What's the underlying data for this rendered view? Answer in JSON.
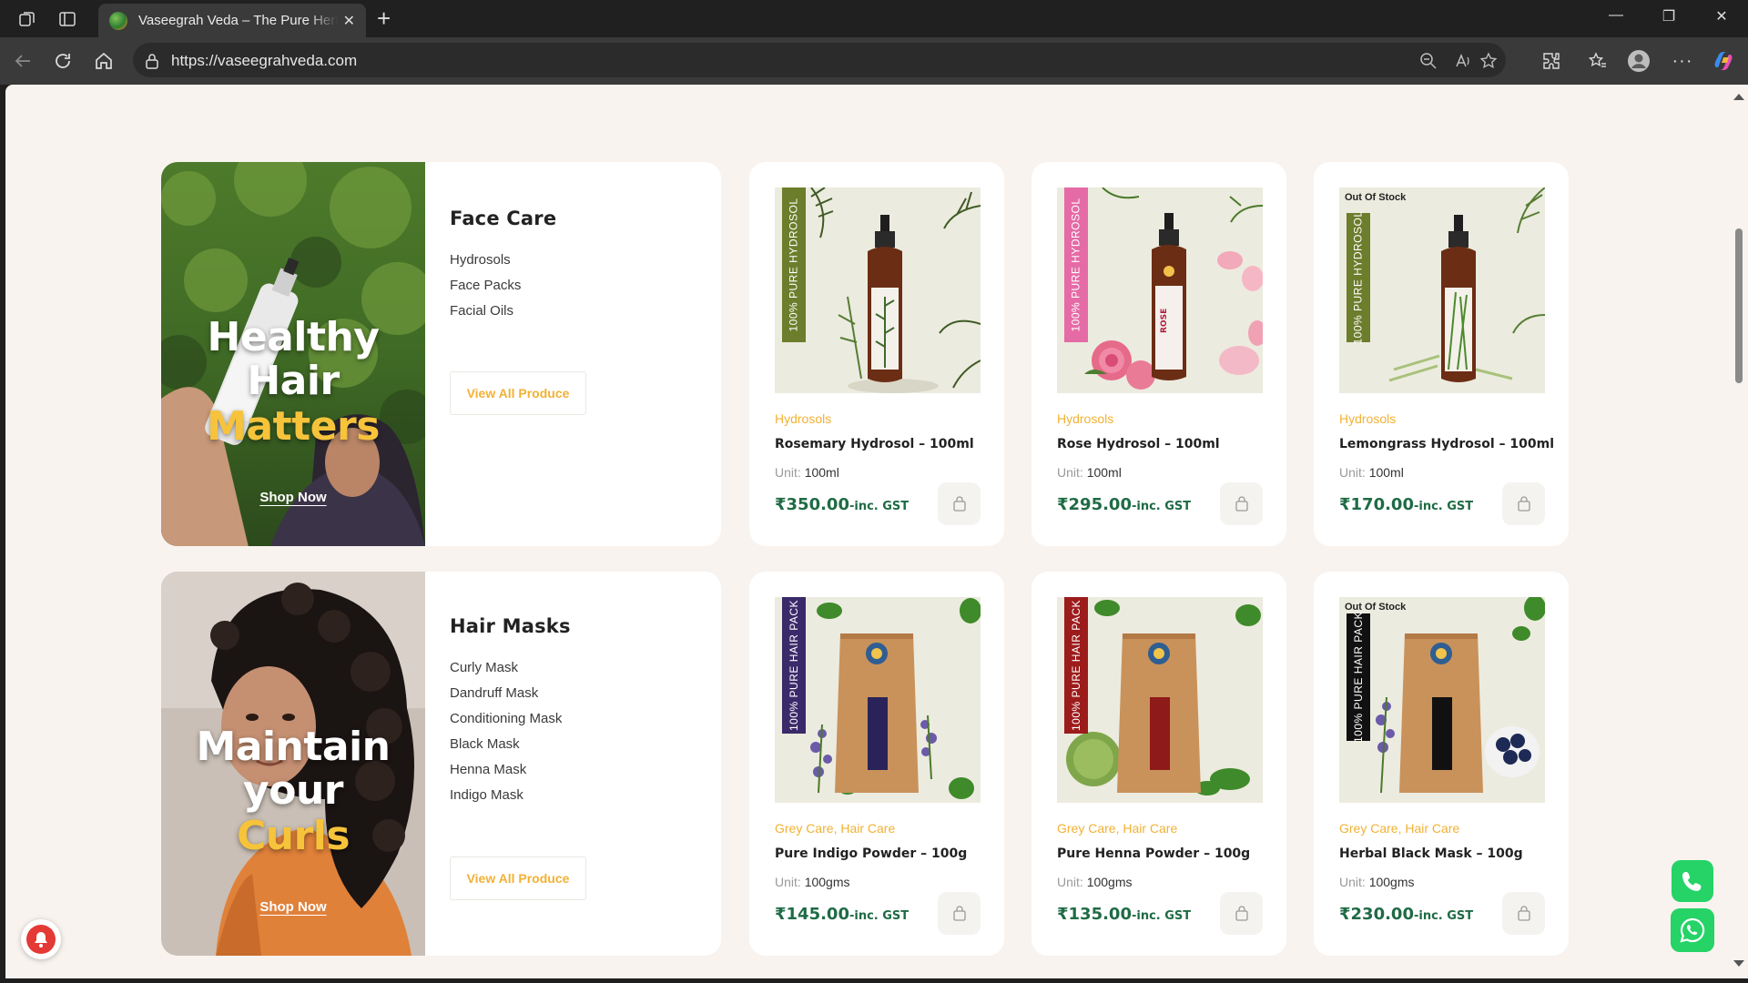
{
  "browser": {
    "tab_title": "Vaseegrah Veda – The Pure Herbal",
    "url": "https://vaseegrahveda.com"
  },
  "categories": [
    {
      "banner": {
        "line1": "Healthy",
        "line2": "Hair",
        "line3": "Matters",
        "cta": "Shop Now"
      },
      "title": "Face Care",
      "links": [
        "Hydrosols",
        "Face Packs",
        "Facial Oils"
      ],
      "button": "View All Produce",
      "products": [
        {
          "category": "Hydrosols",
          "name": "Rosemary Hydrosol – 100ml",
          "unit_label": "Unit:",
          "unit": "100ml",
          "price": "₹350.00",
          "gst": "-inc. GST",
          "band": "100% PURE HYDROSOL",
          "band_color": "#6c7d2c",
          "badge": ""
        },
        {
          "category": "Hydrosols",
          "name": "Rose Hydrosol – 100ml",
          "unit_label": "Unit:",
          "unit": "100ml",
          "price": "₹295.00",
          "gst": "-inc. GST",
          "band": "100% PURE HYDROSOL",
          "band_color": "#e46ba6",
          "badge": ""
        },
        {
          "category": "Hydrosols",
          "name": "Lemongrass Hydrosol – 100ml",
          "unit_label": "Unit:",
          "unit": "100ml",
          "price": "₹170.00",
          "gst": "-inc. GST",
          "band": "100% PURE HYDROSOL",
          "band_color": "#6c7d2c",
          "badge": "Out Of Stock"
        }
      ]
    },
    {
      "banner": {
        "line1": "Maintain",
        "line2": "your",
        "line3": "Curls",
        "cta": "Shop Now"
      },
      "title": "Hair Masks",
      "links": [
        "Curly Mask",
        "Dandruff Mask",
        "Conditioning Mask",
        "Black Mask",
        "Henna Mask",
        "Indigo Mask"
      ],
      "button": "View All Produce",
      "products": [
        {
          "category": "Grey Care, Hair Care",
          "name": "Pure Indigo Powder – 100g",
          "unit_label": "Unit:",
          "unit": "100gms",
          "price": "₹145.00",
          "gst": "-inc. GST",
          "band": "100% PURE HAIR PACK",
          "band_color": "#3a2a6a",
          "badge": ""
        },
        {
          "category": "Grey Care, Hair Care",
          "name": "Pure Henna Powder – 100g",
          "unit_label": "Unit:",
          "unit": "100gms",
          "price": "₹135.00",
          "gst": "-inc. GST",
          "band": "100% PURE HAIR PACK",
          "band_color": "#9c1c1c",
          "badge": ""
        },
        {
          "category": "Grey Care, Hair Care",
          "name": "Herbal Black Mask – 100g",
          "unit_label": "Unit:",
          "unit": "100gms",
          "price": "₹230.00",
          "gst": "-inc. GST",
          "band": "100% PURE HAIR PACK",
          "band_color": "#111111",
          "badge": "Out Of Stock"
        }
      ]
    }
  ],
  "colors": {
    "accent": "#f2b134",
    "price": "#1f6b45",
    "page_bg": "#f8f3ef"
  }
}
